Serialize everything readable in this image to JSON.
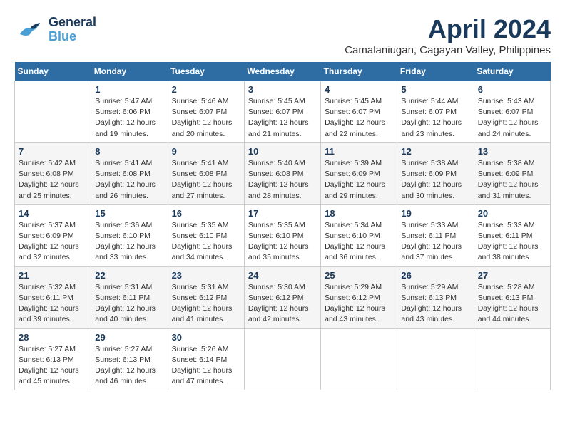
{
  "header": {
    "logo": {
      "general": "General",
      "blue": "Blue"
    },
    "title": "April 2024",
    "location": "Camalaniugan, Cagayan Valley, Philippines"
  },
  "weekdays": [
    "Sunday",
    "Monday",
    "Tuesday",
    "Wednesday",
    "Thursday",
    "Friday",
    "Saturday"
  ],
  "weeks": [
    [
      {
        "day": "",
        "info": ""
      },
      {
        "day": "1",
        "info": "Sunrise: 5:47 AM\nSunset: 6:06 PM\nDaylight: 12 hours\nand 19 minutes."
      },
      {
        "day": "2",
        "info": "Sunrise: 5:46 AM\nSunset: 6:07 PM\nDaylight: 12 hours\nand 20 minutes."
      },
      {
        "day": "3",
        "info": "Sunrise: 5:45 AM\nSunset: 6:07 PM\nDaylight: 12 hours\nand 21 minutes."
      },
      {
        "day": "4",
        "info": "Sunrise: 5:45 AM\nSunset: 6:07 PM\nDaylight: 12 hours\nand 22 minutes."
      },
      {
        "day": "5",
        "info": "Sunrise: 5:44 AM\nSunset: 6:07 PM\nDaylight: 12 hours\nand 23 minutes."
      },
      {
        "day": "6",
        "info": "Sunrise: 5:43 AM\nSunset: 6:07 PM\nDaylight: 12 hours\nand 24 minutes."
      }
    ],
    [
      {
        "day": "7",
        "info": "Sunrise: 5:42 AM\nSunset: 6:08 PM\nDaylight: 12 hours\nand 25 minutes."
      },
      {
        "day": "8",
        "info": "Sunrise: 5:41 AM\nSunset: 6:08 PM\nDaylight: 12 hours\nand 26 minutes."
      },
      {
        "day": "9",
        "info": "Sunrise: 5:41 AM\nSunset: 6:08 PM\nDaylight: 12 hours\nand 27 minutes."
      },
      {
        "day": "10",
        "info": "Sunrise: 5:40 AM\nSunset: 6:08 PM\nDaylight: 12 hours\nand 28 minutes."
      },
      {
        "day": "11",
        "info": "Sunrise: 5:39 AM\nSunset: 6:09 PM\nDaylight: 12 hours\nand 29 minutes."
      },
      {
        "day": "12",
        "info": "Sunrise: 5:38 AM\nSunset: 6:09 PM\nDaylight: 12 hours\nand 30 minutes."
      },
      {
        "day": "13",
        "info": "Sunrise: 5:38 AM\nSunset: 6:09 PM\nDaylight: 12 hours\nand 31 minutes."
      }
    ],
    [
      {
        "day": "14",
        "info": "Sunrise: 5:37 AM\nSunset: 6:09 PM\nDaylight: 12 hours\nand 32 minutes."
      },
      {
        "day": "15",
        "info": "Sunrise: 5:36 AM\nSunset: 6:10 PM\nDaylight: 12 hours\nand 33 minutes."
      },
      {
        "day": "16",
        "info": "Sunrise: 5:35 AM\nSunset: 6:10 PM\nDaylight: 12 hours\nand 34 minutes."
      },
      {
        "day": "17",
        "info": "Sunrise: 5:35 AM\nSunset: 6:10 PM\nDaylight: 12 hours\nand 35 minutes."
      },
      {
        "day": "18",
        "info": "Sunrise: 5:34 AM\nSunset: 6:10 PM\nDaylight: 12 hours\nand 36 minutes."
      },
      {
        "day": "19",
        "info": "Sunrise: 5:33 AM\nSunset: 6:11 PM\nDaylight: 12 hours\nand 37 minutes."
      },
      {
        "day": "20",
        "info": "Sunrise: 5:33 AM\nSunset: 6:11 PM\nDaylight: 12 hours\nand 38 minutes."
      }
    ],
    [
      {
        "day": "21",
        "info": "Sunrise: 5:32 AM\nSunset: 6:11 PM\nDaylight: 12 hours\nand 39 minutes."
      },
      {
        "day": "22",
        "info": "Sunrise: 5:31 AM\nSunset: 6:11 PM\nDaylight: 12 hours\nand 40 minutes."
      },
      {
        "day": "23",
        "info": "Sunrise: 5:31 AM\nSunset: 6:12 PM\nDaylight: 12 hours\nand 41 minutes."
      },
      {
        "day": "24",
        "info": "Sunrise: 5:30 AM\nSunset: 6:12 PM\nDaylight: 12 hours\nand 42 minutes."
      },
      {
        "day": "25",
        "info": "Sunrise: 5:29 AM\nSunset: 6:12 PM\nDaylight: 12 hours\nand 43 minutes."
      },
      {
        "day": "26",
        "info": "Sunrise: 5:29 AM\nSunset: 6:13 PM\nDaylight: 12 hours\nand 43 minutes."
      },
      {
        "day": "27",
        "info": "Sunrise: 5:28 AM\nSunset: 6:13 PM\nDaylight: 12 hours\nand 44 minutes."
      }
    ],
    [
      {
        "day": "28",
        "info": "Sunrise: 5:27 AM\nSunset: 6:13 PM\nDaylight: 12 hours\nand 45 minutes."
      },
      {
        "day": "29",
        "info": "Sunrise: 5:27 AM\nSunset: 6:13 PM\nDaylight: 12 hours\nand 46 minutes."
      },
      {
        "day": "30",
        "info": "Sunrise: 5:26 AM\nSunset: 6:14 PM\nDaylight: 12 hours\nand 47 minutes."
      },
      {
        "day": "",
        "info": ""
      },
      {
        "day": "",
        "info": ""
      },
      {
        "day": "",
        "info": ""
      },
      {
        "day": "",
        "info": ""
      }
    ]
  ]
}
